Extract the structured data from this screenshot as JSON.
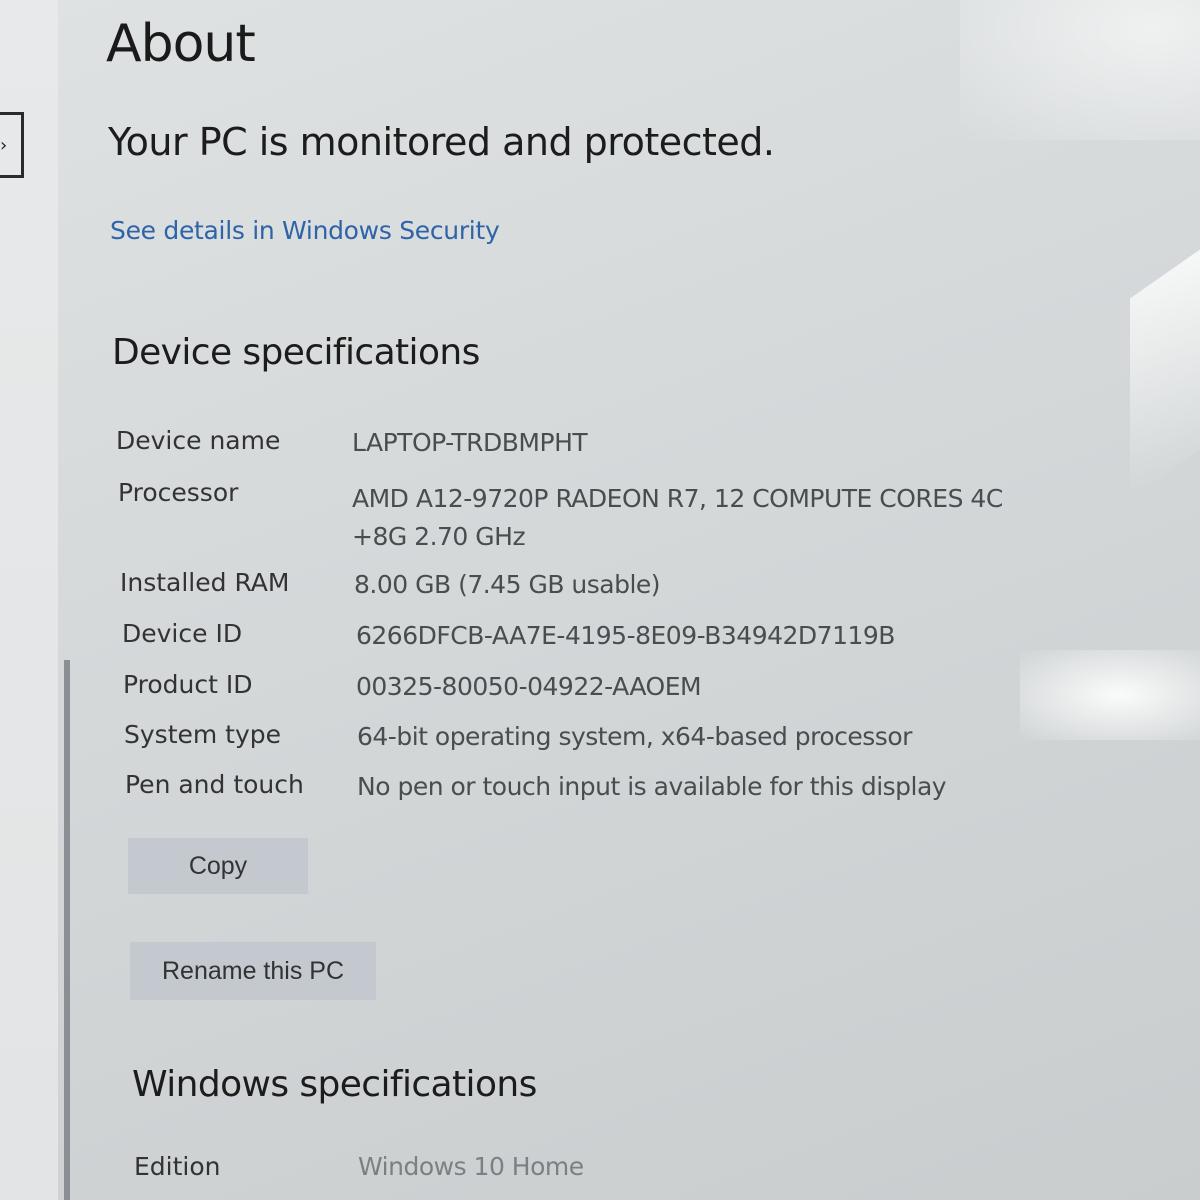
{
  "page": {
    "title": "About"
  },
  "security": {
    "status": "Your PC is monitored and protected.",
    "link": "See details in Windows Security"
  },
  "device_specs": {
    "heading": "Device specifications",
    "rows": [
      {
        "label": "Device name",
        "value": "LAPTOP-TRDBMPHT"
      },
      {
        "label": "Processor",
        "value": "AMD A12-9720P RADEON R7, 12 COMPUTE CORES 4C +8G   2.70 GHz"
      },
      {
        "label": "Installed RAM",
        "value": "8.00 GB (7.45 GB usable)"
      },
      {
        "label": "Device ID",
        "value": "6266DFCB-AA7E-4195-8E09-B34942D7119B"
      },
      {
        "label": "Product ID",
        "value": "00325-80050-04922-AAOEM"
      },
      {
        "label": "System type",
        "value": "64-bit operating system, x64-based processor"
      },
      {
        "label": "Pen and touch",
        "value": "No pen or touch input is available for this display"
      }
    ],
    "copy_button": "Copy",
    "rename_button": "Rename this PC"
  },
  "windows_specs": {
    "heading": "Windows specifications",
    "rows": [
      {
        "label": "Edition",
        "value": "Windows 10 Home"
      }
    ]
  },
  "nav": {
    "edge_glyph": "›"
  }
}
